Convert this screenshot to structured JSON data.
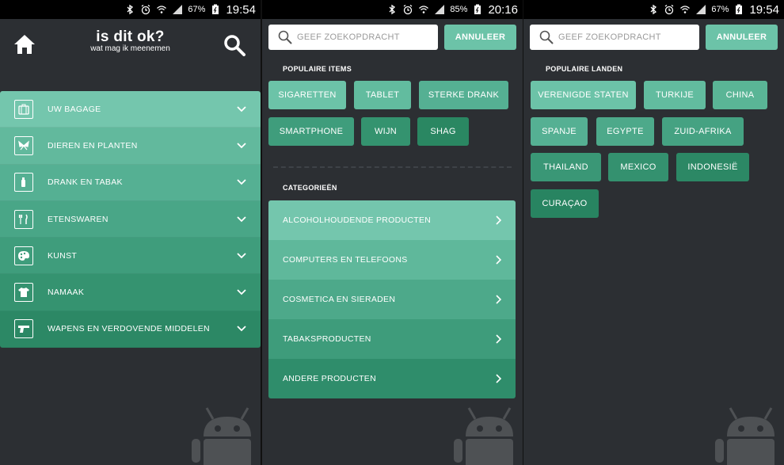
{
  "status": {
    "p1": {
      "battery": "67%",
      "time": "19:54"
    },
    "p2": {
      "battery": "85%",
      "time": "20:16"
    },
    "p3": {
      "battery": "67%",
      "time": "19:54"
    }
  },
  "home": {
    "title": "is dit ok?",
    "subtitle": "wat mag ik meenemen",
    "menu": [
      {
        "label": "UW BAGAGE",
        "icon": "luggage-icon",
        "color": "#74c6ad"
      },
      {
        "label": "DIEREN EN PLANTEN",
        "icon": "butterfly-icon",
        "color": "#62b99d"
      },
      {
        "label": "DRANK EN TABAK",
        "icon": "bottle-icon",
        "color": "#55b093"
      },
      {
        "label": "ETENSWAREN",
        "icon": "cutlery-icon",
        "color": "#49a687"
      },
      {
        "label": "KUNST",
        "icon": "palette-icon",
        "color": "#3f9d7c"
      },
      {
        "label": "NAMAAK",
        "icon": "tshirt-icon",
        "color": "#359370"
      },
      {
        "label": "WAPENS EN VERDOVENDE MIDDELEN",
        "icon": "gun-icon",
        "color": "#2c8865"
      }
    ]
  },
  "search": {
    "placeholder": "GEEF ZOEKOPDRACHT",
    "cancel_label": "ANNULEER"
  },
  "items_screen": {
    "popular_title": "POPULAIRE ITEMS",
    "popular": [
      {
        "label": "SIGARETTEN",
        "color": "#6cc3a8"
      },
      {
        "label": "TABLET",
        "color": "#62bc9f"
      },
      {
        "label": "STERKE DRANK",
        "color": "#55b093"
      },
      {
        "label": "SMARTPHONE",
        "color": "#3f9d7c"
      },
      {
        "label": "WIJN",
        "color": "#34936f"
      },
      {
        "label": "SHAG",
        "color": "#2a8762"
      }
    ],
    "categories_title": "CATEGORIEËN",
    "categories": [
      {
        "label": "ALCOHOLHOUDENDE PRODUCTEN",
        "color": "#74c6ad"
      },
      {
        "label": "COMPUTERS EN TELEFOONS",
        "color": "#5fb89b"
      },
      {
        "label": "COSMETICA EN SIERADEN",
        "color": "#4da98a"
      },
      {
        "label": "TABAKSPRODUCTEN",
        "color": "#3e9c7b"
      },
      {
        "label": "ANDERE PRODUCTEN",
        "color": "#2f8d6b"
      }
    ]
  },
  "countries_screen": {
    "popular_title": "POPULAIRE LANDEN",
    "countries": [
      {
        "label": "VERENIGDE STATEN",
        "color": "#6cc3a8"
      },
      {
        "label": "TURKIJE",
        "color": "#62bc9f"
      },
      {
        "label": "CHINA",
        "color": "#5ab596"
      },
      {
        "label": "SPANJE",
        "color": "#55b093"
      },
      {
        "label": "EGYPTE",
        "color": "#4da98a"
      },
      {
        "label": "ZUID-AFRIKA",
        "color": "#45a282"
      },
      {
        "label": "THAILAND",
        "color": "#3a9776"
      },
      {
        "label": "MEXICO",
        "color": "#34916f"
      },
      {
        "label": "INDONESIË",
        "color": "#2c8865"
      },
      {
        "label": "CURAÇAO",
        "color": "#288461"
      }
    ]
  }
}
